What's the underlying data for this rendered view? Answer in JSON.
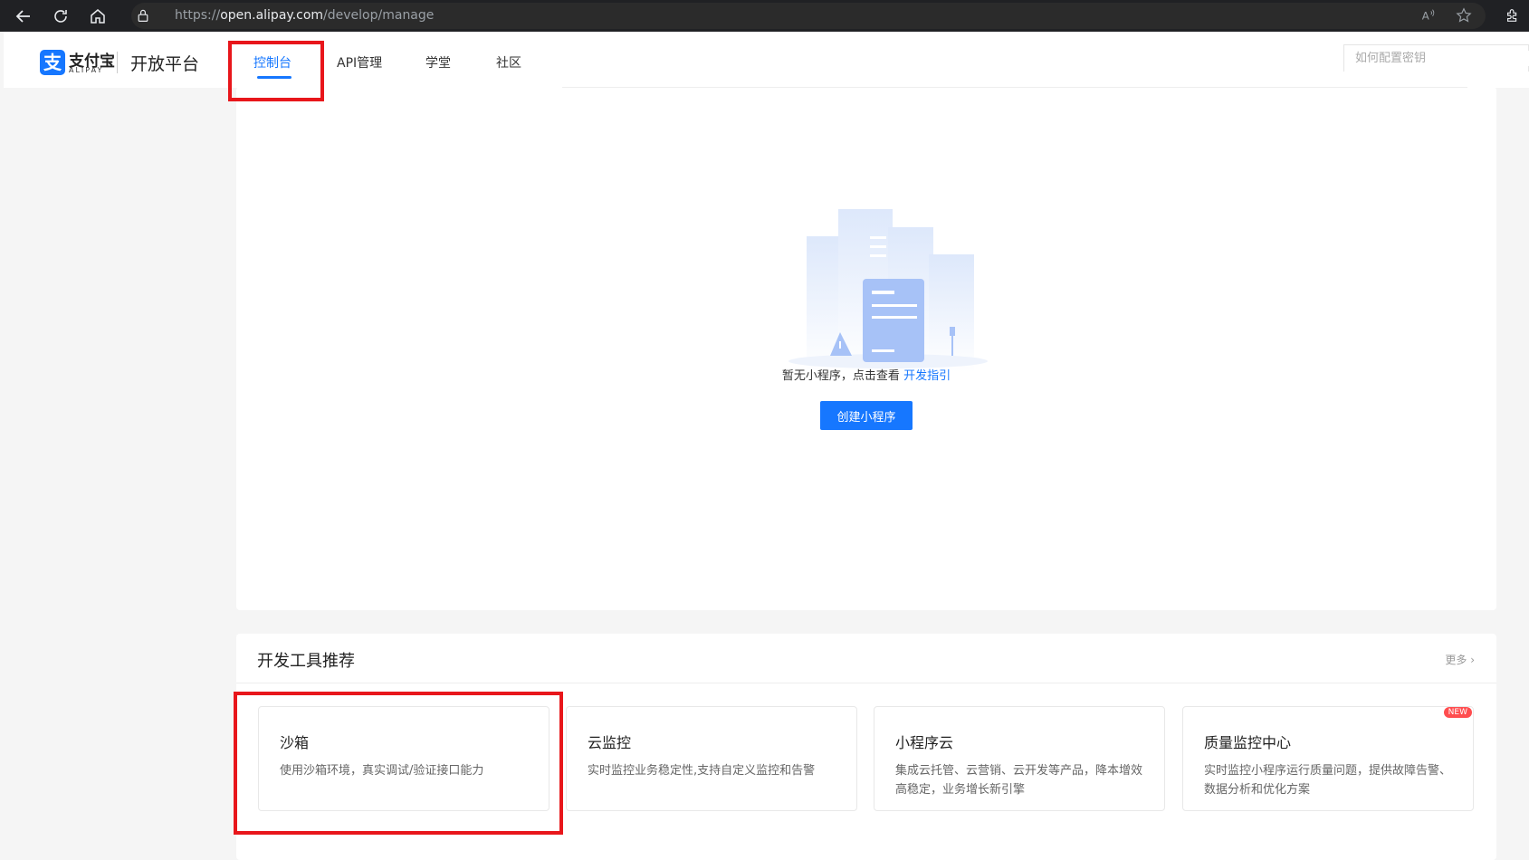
{
  "browser": {
    "url_scheme": "https://",
    "url_host": "open.alipay.com",
    "url_path": "/develop/manage"
  },
  "header": {
    "logo_cn": "支付宝",
    "logo_en": "ALIPAY",
    "platform": "开放平台",
    "nav": [
      "控制台",
      "API管理",
      "学堂",
      "社区"
    ],
    "active_nav": "控制台",
    "search_placeholder": "如何配置密钥"
  },
  "empty_state": {
    "message": "暂无小程序，点击查看 ",
    "link": "开发指引",
    "button": "创建小程序"
  },
  "tools": {
    "title": "开发工具推荐",
    "more": "更多",
    "items": [
      {
        "title": "沙箱",
        "desc": "使用沙箱环境，真实调试/验证接口能力"
      },
      {
        "title": "云监控",
        "desc": "实时监控业务稳定性,支持自定义监控和告警"
      },
      {
        "title": "小程序云",
        "desc": "集成云托管、云营销、云开发等产品，降本增效高稳定，业务增长新引擎"
      },
      {
        "title": "质量监控中心",
        "desc": "实时监控小程序运行质量问题，提供故障告警、数据分析和优化方案",
        "badge": "NEW"
      }
    ]
  },
  "colors": {
    "brand": "#1677ff",
    "highlight_box": "#e8161b"
  }
}
